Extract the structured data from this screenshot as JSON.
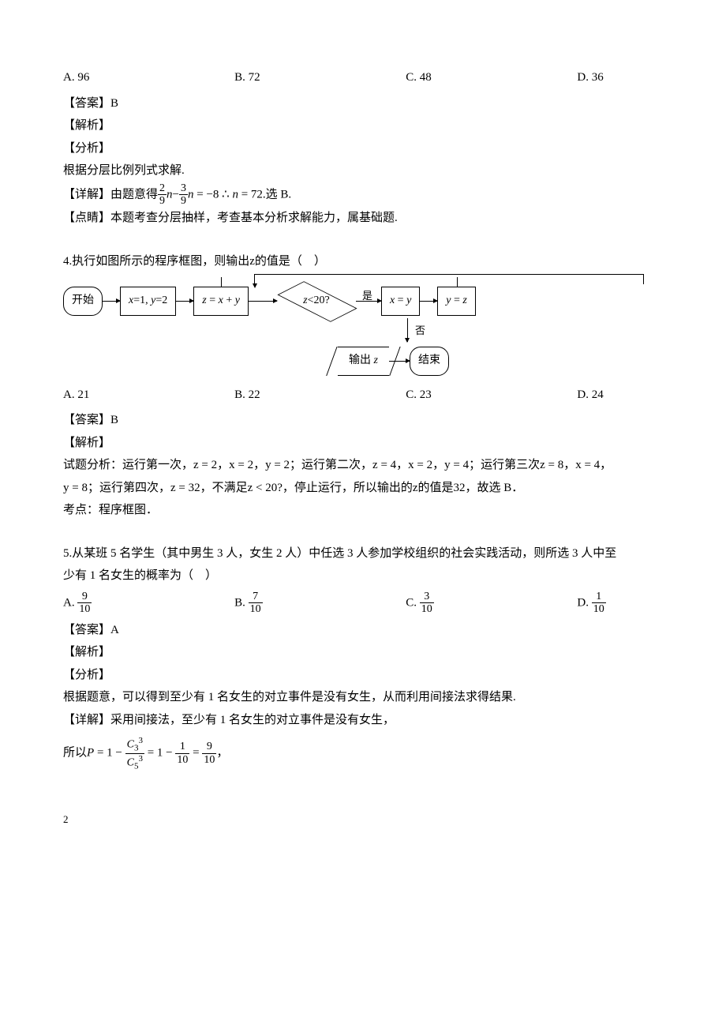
{
  "q3": {
    "options": {
      "A": "A. 96",
      "B": "B. 72",
      "C": "C. 48",
      "D": "D. 36"
    },
    "answer_label": "【答案】B",
    "jiexi": "【解析】",
    "fenxi": "【分析】",
    "fenxi_body": "根据分层比例列式求解.",
    "xiangjie_prefix": "【详解】由题意得",
    "eq_mid": " = −8 ∴ ",
    "eq_end": " = 72.选 B.",
    "dianjing": "【点睛】本题考查分层抽样，考查基本分析求解能力，属基础题."
  },
  "q4": {
    "stem": "4.执行如图所示的程序框图，则输出z的值是（　）",
    "options": {
      "A": "A. 21",
      "B": "B. 22",
      "C": "C. 23",
      "D": "D. 24"
    },
    "answer_label": "【答案】B",
    "jiexi": "【解析】",
    "analysis_l1": "试题分析：运行第一次，z = 2，x = 2，y = 2；运行第二次，z = 4，x = 2，y = 4；运行第三次z = 8，x = 4，",
    "analysis_l2": "y = 8；运行第四次，z = 32，不满足z < 20?，停止运行，所以输出的z的值是32，故选 B．",
    "kaodian": "考点：程序框图．",
    "flow": {
      "start": "开始",
      "init": "x=1, y=2",
      "step": "z = x + y",
      "cond": "z<20?",
      "yes": "是",
      "no": "否",
      "assign1": "x = y",
      "assign2": "y = z",
      "output": "输出 z",
      "end": "结束"
    }
  },
  "q5": {
    "stem_l1": "5.从某班 5 名学生（其中男生 3 人，女生 2 人）中任选 3 人参加学校组织的社会实践活动，则所选 3 人中至",
    "stem_l2": "少有 1 名女生的概率为（　）",
    "options": {
      "A": {
        "label": "A. ",
        "num": "9",
        "den": "10"
      },
      "B": {
        "label": "B. ",
        "num": "7",
        "den": "10"
      },
      "C": {
        "label": "C. ",
        "num": "3",
        "den": "10"
      },
      "D": {
        "label": "D. ",
        "num": "1",
        "den": "10"
      }
    },
    "answer_label": "【答案】A",
    "jiexi": "【解析】",
    "fenxi": "【分析】",
    "fenxi_body": "根据题意，可以得到至少有 1 名女生的对立事件是没有女生，从而利用间接法求得结果.",
    "xiangjie": "【详解】采用间接法，至少有 1 名女生的对立事件是没有女生，",
    "calc_prefix": "所以",
    "calc_suffix": "，"
  },
  "page_number": "2"
}
